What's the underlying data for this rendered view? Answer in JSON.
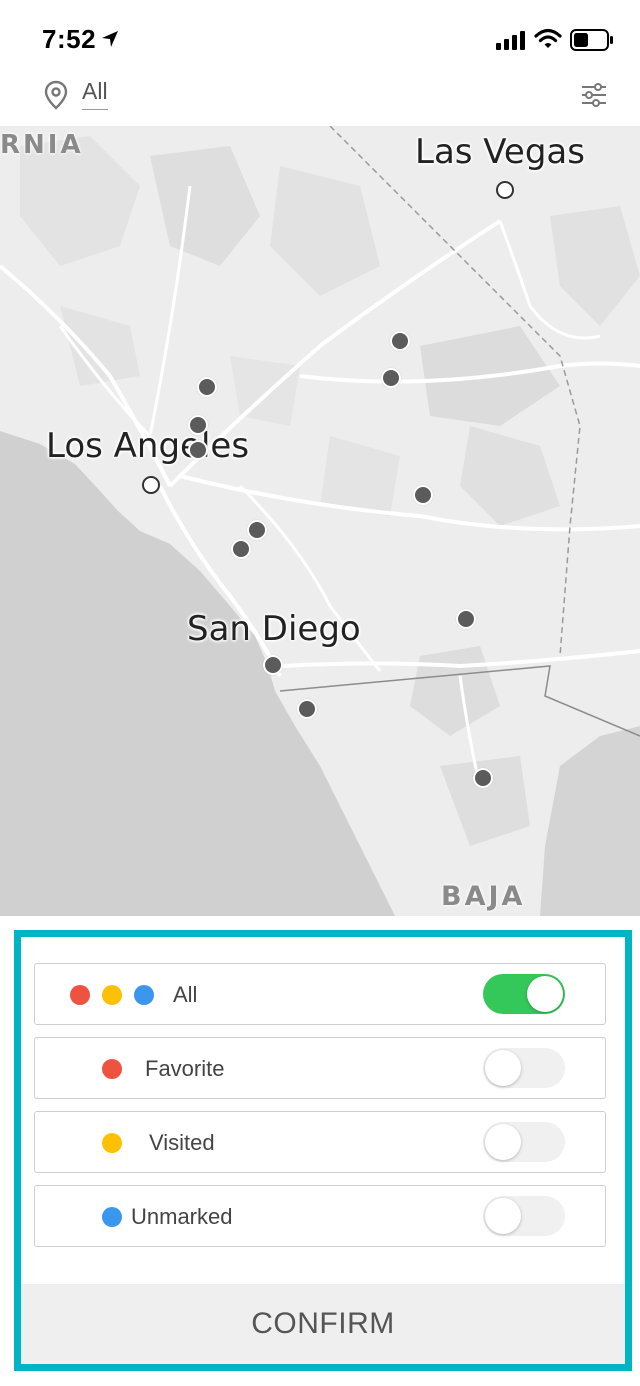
{
  "status_bar": {
    "time": "7:52",
    "icons": [
      "location-arrow-icon",
      "cellular-signal-icon",
      "wifi-icon",
      "battery-icon"
    ]
  },
  "header": {
    "filter_label": "All",
    "icons": [
      "map-pin-icon",
      "settings-sliders-icon"
    ]
  },
  "map": {
    "labels": {
      "region_top": "RNIA",
      "las_vegas": "Las Vegas",
      "los_angeles": "Los Angeles",
      "san_diego": "San Diego",
      "region_bottom": "BAJA"
    },
    "marker_count": 13
  },
  "filter_panel": {
    "rows": [
      {
        "label": "All",
        "dots": [
          "#ef5340",
          "#fdc007",
          "#3b97ee"
        ],
        "enabled": true
      },
      {
        "label": "Favorite",
        "dots": [
          "#ef5340"
        ],
        "enabled": false
      },
      {
        "label": "Visited",
        "dots": [
          "#fdc007"
        ],
        "enabled": false
      },
      {
        "label": "Unmarked",
        "dots": [
          "#3b97ee"
        ],
        "enabled": false
      }
    ],
    "confirm_label": "CONFIRM"
  },
  "colors": {
    "accent_border": "#00b4c3",
    "toggle_on": "#34c759",
    "red": "#ef5340",
    "yellow": "#fdc007",
    "blue": "#3b97ee"
  }
}
